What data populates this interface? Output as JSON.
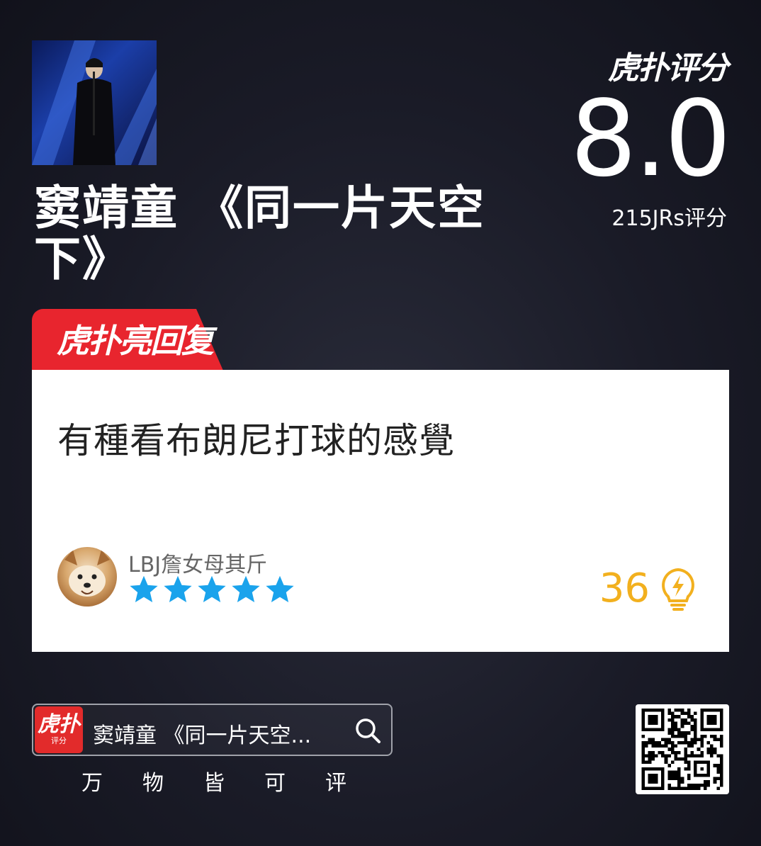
{
  "header": {
    "title": "窦靖童 《同一片天空下》",
    "rating_logo": "虎扑评分",
    "score": "8.0",
    "rating_count": "215JRs评分"
  },
  "highlight": {
    "tag": "虎扑亮回复"
  },
  "comment": {
    "text": "有種看布朗尼打球的感覺",
    "username": "LBJ詹女母其斤",
    "stars": 5,
    "likes": "36"
  },
  "footer": {
    "app_icon_big": "虎扑",
    "app_icon_small": "评分",
    "search_text": "窦靖童 《同一片天空...",
    "slogan": [
      "万",
      "物",
      "皆",
      "可",
      "评"
    ]
  },
  "colors": {
    "accent_red": "#e8252e",
    "star_blue": "#1aa3ec",
    "like_yellow": "#f2b01e"
  },
  "icons": {
    "search": "search-icon",
    "lightbulb": "lightbulb-icon",
    "star": "star-icon"
  }
}
